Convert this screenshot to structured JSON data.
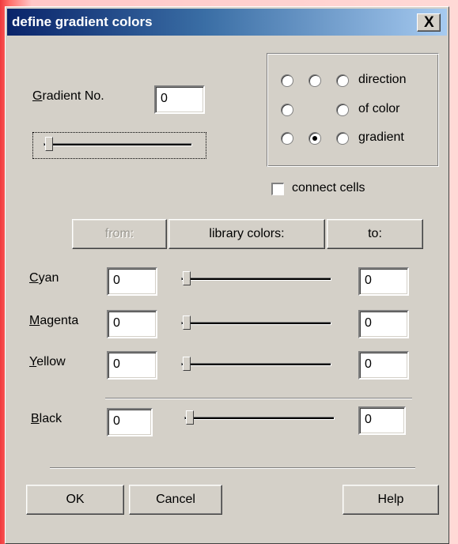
{
  "window": {
    "title": "define gradient colors",
    "close_label": "X"
  },
  "gradient": {
    "label_u": "G",
    "label_rest": "radient No.",
    "value": "0",
    "slider_fraction": 0
  },
  "direction_group": {
    "labels": [
      "direction",
      "of color",
      "gradient"
    ],
    "selected": "row3-col2"
  },
  "connect_cells": {
    "label": "connect cells",
    "checked": false
  },
  "buttons_top": {
    "from": "from:",
    "library": "library colors:",
    "to": "to:"
  },
  "colors": [
    {
      "label_u": "C",
      "label_rest": "yan",
      "from": "0",
      "to": "0",
      "slider_fraction": 0
    },
    {
      "label_u": "M",
      "label_rest": "agenta",
      "from": "0",
      "to": "0",
      "slider_fraction": 0
    },
    {
      "label_u": "Y",
      "label_rest": "ellow",
      "from": "0",
      "to": "0",
      "slider_fraction": 0
    },
    {
      "label_u": "B",
      "label_rest": "lack",
      "from": "0",
      "to": "0",
      "slider_fraction": 0
    }
  ],
  "footer": {
    "ok": "OK",
    "cancel": "Cancel",
    "help": "Help"
  }
}
